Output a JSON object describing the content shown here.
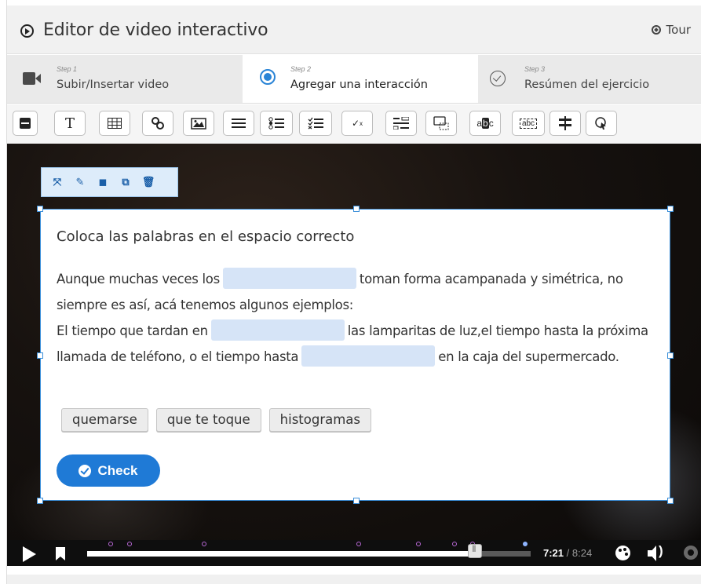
{
  "header": {
    "title": "Editor de video interactivo",
    "tour_label": "Tour"
  },
  "steps": [
    {
      "num": "Step 1",
      "label": "Subir/Insertar video",
      "icon": "video-camera-icon",
      "active": false
    },
    {
      "num": "Step 2",
      "label": "Agregar una interacción",
      "icon": "touch-icon",
      "active": true
    },
    {
      "num": "Step 3",
      "label": "Resúmen del ejercicio",
      "icon": "check-circle-icon",
      "active": false
    }
  ],
  "toolbar": {
    "tools": [
      "label-icon",
      "text-icon",
      "table-icon",
      "link-icon",
      "image-icon",
      "statements-icon",
      "single-choice-icon",
      "multiple-choice-icon",
      "true-false-icon",
      "fill-blanks-icon",
      "drag-drop-icon",
      "mark-words-icon",
      "drag-text-icon",
      "crossroads-icon",
      "navigation-hotspot-icon"
    ]
  },
  "mini_toolbar": {
    "tools": [
      "expand-icon",
      "edit-icon",
      "bring-to-front-icon",
      "copy-icon",
      "delete-icon"
    ]
  },
  "card": {
    "title": "Coloca las palabras en el espacio correcto",
    "segments": {
      "s1": "Aunque muchas veces los",
      "s2": "toman forma acampanada y simétrica, no siempre es así, acá tenemos algunos ejemplos:",
      "s3": "El tiempo que tardan en",
      "s4": "las lamparitas de luz,el tiempo hasta la próxima llamada de teléfono, o el tiempo hasta",
      "s5": "en la caja del supermercado."
    },
    "words": [
      "quemarse",
      "que te toque",
      "histogramas"
    ],
    "check_label": "Check"
  },
  "player": {
    "current_time": "7:21",
    "total_time": "/ 8:24",
    "progress_fraction": 0.875,
    "accent_color": "#b868d6"
  }
}
